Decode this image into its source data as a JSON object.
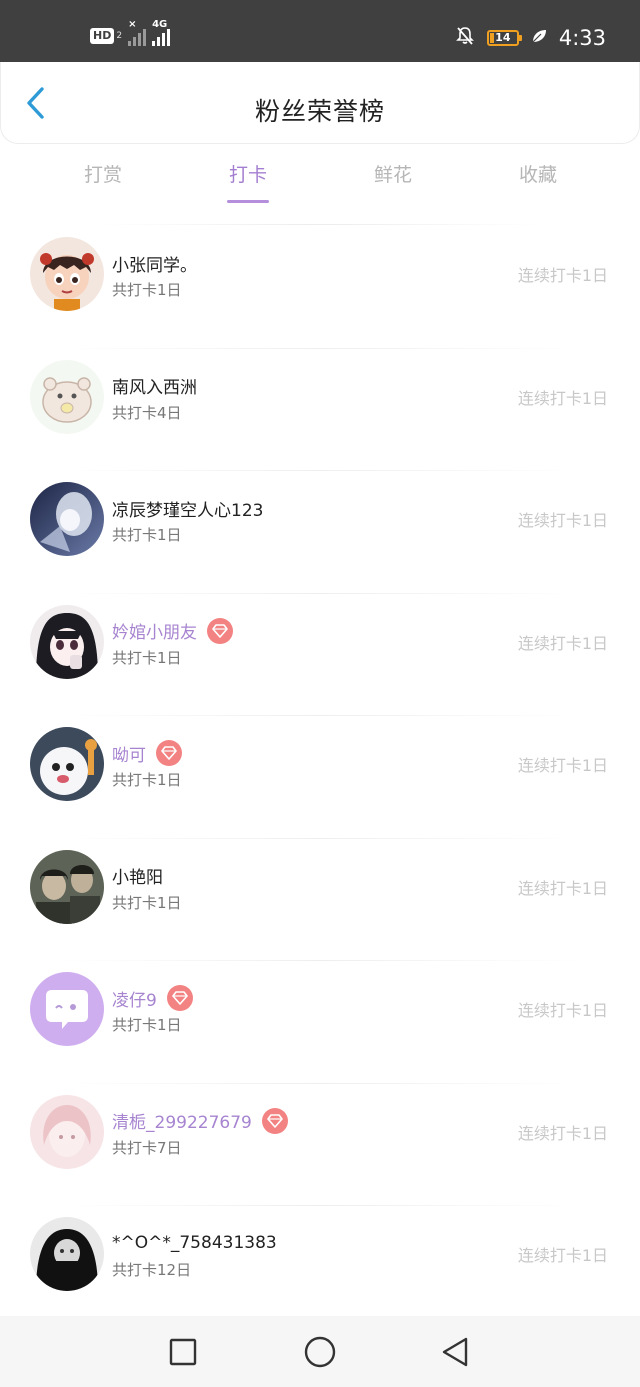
{
  "status_bar": {
    "hd_label": "HD",
    "hd_sub": "2",
    "network_label": "4G",
    "battery_level": "14",
    "battery_fraction": 0.14,
    "time": "4:33"
  },
  "header": {
    "title": "粉丝荣誉榜"
  },
  "tabs": [
    {
      "label": "打赏",
      "active": false
    },
    {
      "label": "打卡",
      "active": true
    },
    {
      "label": "鲜花",
      "active": false
    },
    {
      "label": "收藏",
      "active": false
    }
  ],
  "fans": [
    {
      "name": "小张同学。",
      "vip": false,
      "total": "共打卡1日",
      "streak": "连续打卡1日",
      "avatar": "cartoon-girl"
    },
    {
      "name": "南风入西洲",
      "vip": false,
      "total": "共打卡4日",
      "streak": "连续打卡1日",
      "avatar": "hamster"
    },
    {
      "name": "凉辰梦瑾空人心123",
      "vip": false,
      "total": "共打卡1日",
      "streak": "连续打卡1日",
      "avatar": "anime-dark-blue"
    },
    {
      "name": "妗婠小朋友",
      "vip": true,
      "total": "共打卡1日",
      "streak": "连续打卡1日",
      "avatar": "anime-girl"
    },
    {
      "name": "呦可",
      "vip": true,
      "total": "共打卡1日",
      "streak": "连续打卡1日",
      "avatar": "white-dog"
    },
    {
      "name": "小艳阳",
      "vip": false,
      "total": "共打卡1日",
      "streak": "连续打卡1日",
      "avatar": "photo-people"
    },
    {
      "name": "凌仔9",
      "vip": true,
      "total": "共打卡1日",
      "streak": "连续打卡1日",
      "avatar": "purple-chat"
    },
    {
      "name": "清栀_299227679",
      "vip": true,
      "total": "共打卡7日",
      "streak": "连续打卡1日",
      "avatar": "pink-sketch"
    },
    {
      "name": "*^O^*_758431383",
      "vip": false,
      "total": "共打卡12日",
      "streak": "连续打卡1日",
      "avatar": "bw-photo"
    }
  ],
  "nav": {
    "recent_icon": "square-icon",
    "home_icon": "circle-icon",
    "back_icon": "triangle-back-icon"
  },
  "colors": {
    "accent": "#a47fd1",
    "vip_name": "#a784d0",
    "diamond_badge": "#f38383",
    "status_bar_bg": "#404040"
  }
}
